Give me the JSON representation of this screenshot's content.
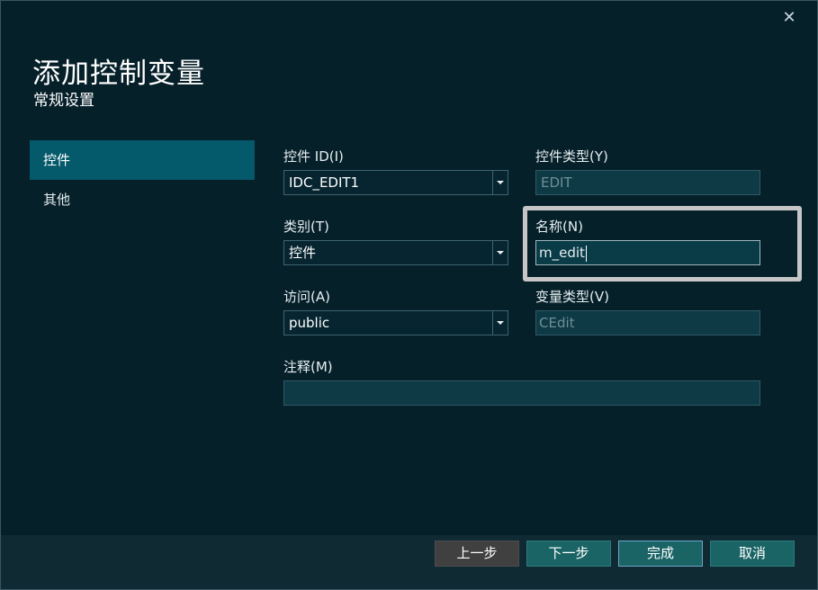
{
  "dialog": {
    "title": "添加控制变量",
    "subtitle": "常规设置",
    "close_glyph": "✕"
  },
  "nav": {
    "items": [
      {
        "label": "控件",
        "active": true
      },
      {
        "label": "其他",
        "active": false
      }
    ]
  },
  "form": {
    "control_id": {
      "label": "控件 ID(I)",
      "value": "IDC_EDIT1"
    },
    "control_type": {
      "label": "控件类型(Y)",
      "value": "EDIT"
    },
    "category": {
      "label": "类别(T)",
      "value": "控件"
    },
    "name": {
      "label": "名称(N)",
      "value": "m_edit"
    },
    "access": {
      "label": "访问(A)",
      "value": "public"
    },
    "variable_type": {
      "label": "变量类型(V)",
      "value": "CEdit"
    },
    "comment": {
      "label": "注释(M)",
      "value": ""
    }
  },
  "buttons": {
    "prev": "上一步",
    "next": "下一步",
    "finish": "完成",
    "cancel": "取消"
  },
  "colors": {
    "background": "#06202a",
    "footer": "#0f2a33",
    "nav_active": "#04596b",
    "button_teal": "#1a6466",
    "button_gray": "#404040",
    "highlight": "#c6c6c6"
  }
}
